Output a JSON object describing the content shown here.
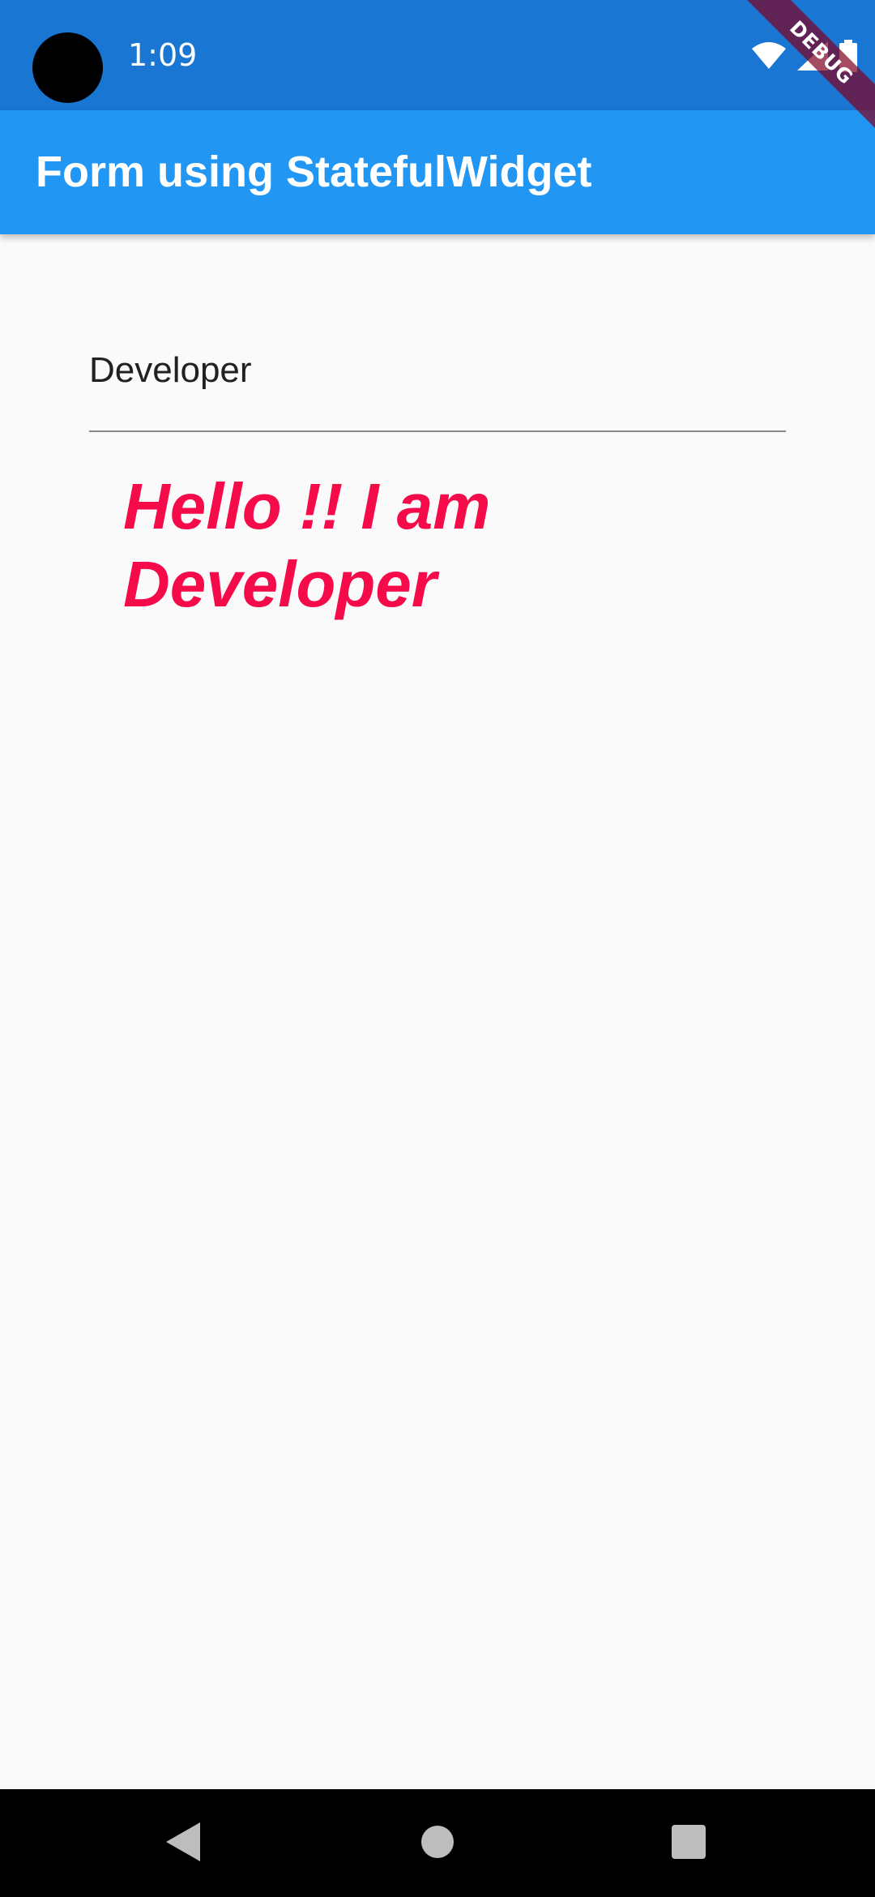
{
  "status_bar": {
    "time": "1:09",
    "icons": [
      "wifi-icon",
      "signal-icon",
      "battery-icon"
    ]
  },
  "debug_banner": {
    "label": "DEBUG"
  },
  "app_bar": {
    "title": "Form using StatefulWidget"
  },
  "form": {
    "name_field": {
      "value": "Developer"
    },
    "greeting": "Hello !!  I am Developer"
  },
  "nav_bar": {
    "buttons": [
      "back-icon",
      "home-icon",
      "recents-icon"
    ]
  },
  "colors": {
    "status_bar": "#1976d2",
    "app_bar": "#2196f3",
    "greeting_text": "#f50a4a",
    "background": "#fafafa",
    "nav_bar": "#000000"
  }
}
